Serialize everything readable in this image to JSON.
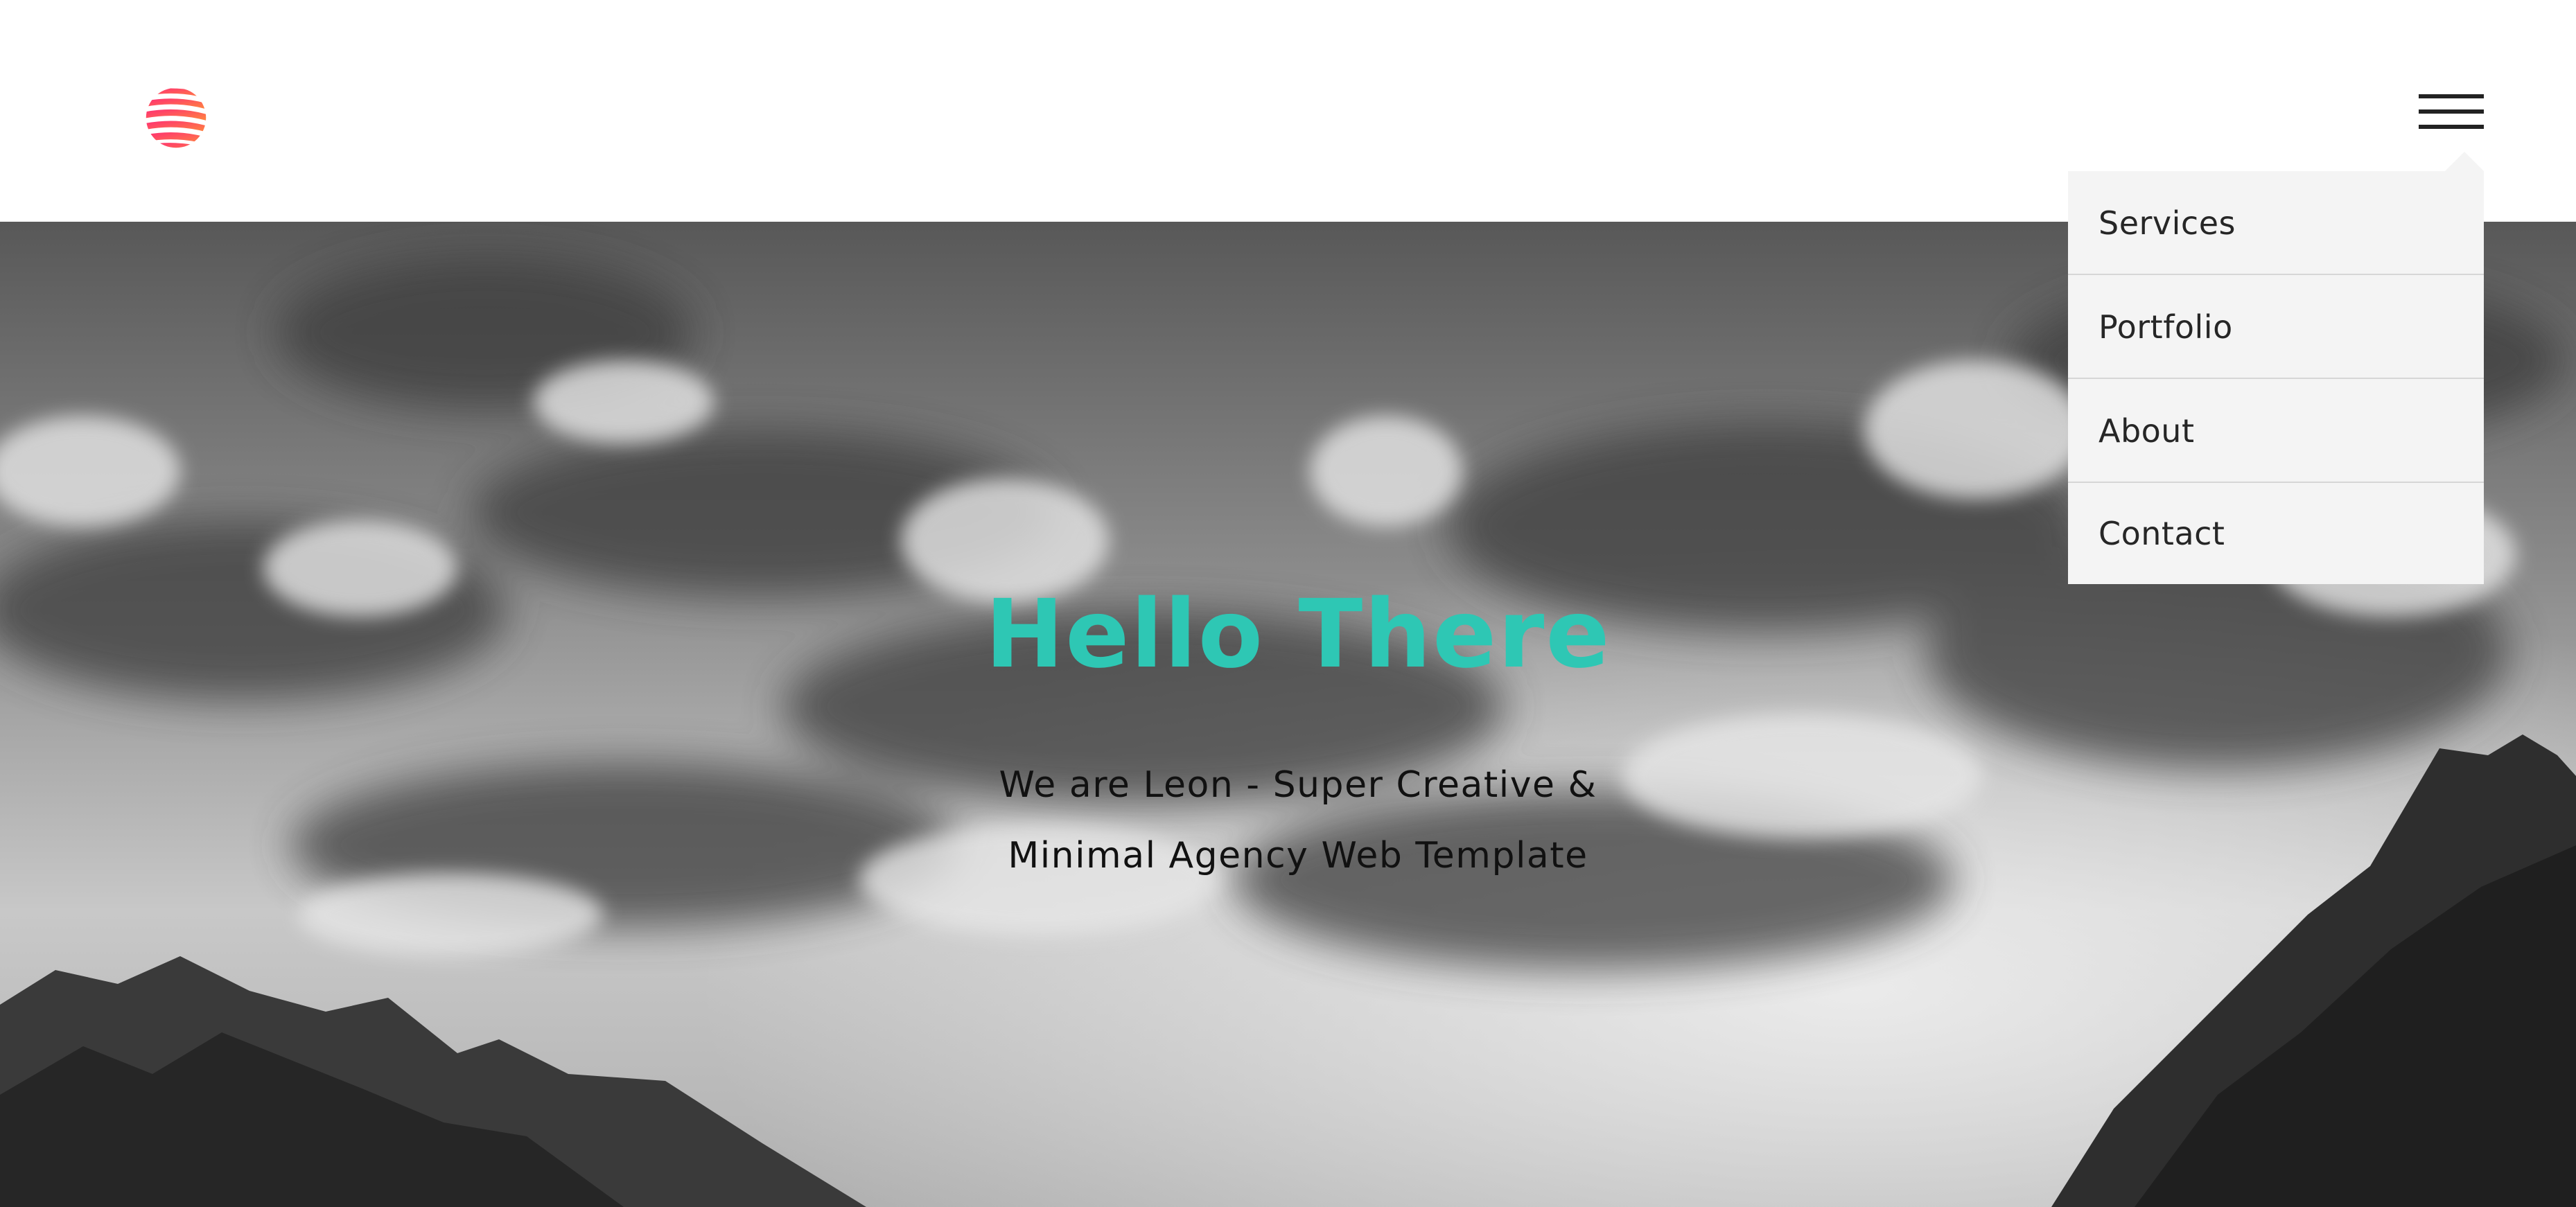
{
  "header": {
    "logo_icon": "striped-globe-logo-icon",
    "menu_icon": "hamburger-menu-icon"
  },
  "hero": {
    "title": "Hello There",
    "subtitle_line1": "We are Leon - Super Creative &",
    "subtitle_line2": "Minimal Agency Web Template",
    "title_color": "#2ec7b4",
    "background": "grayscale-clouds-mountains-photo"
  },
  "nav_menu": {
    "items": [
      {
        "label": "Services"
      },
      {
        "label": "Portfolio"
      },
      {
        "label": "About"
      },
      {
        "label": "Contact"
      }
    ]
  },
  "colors": {
    "logo_gradient_start": "#ff2e74",
    "logo_gradient_end": "#ff8a3d",
    "menu_background": "#f4f4f4"
  }
}
